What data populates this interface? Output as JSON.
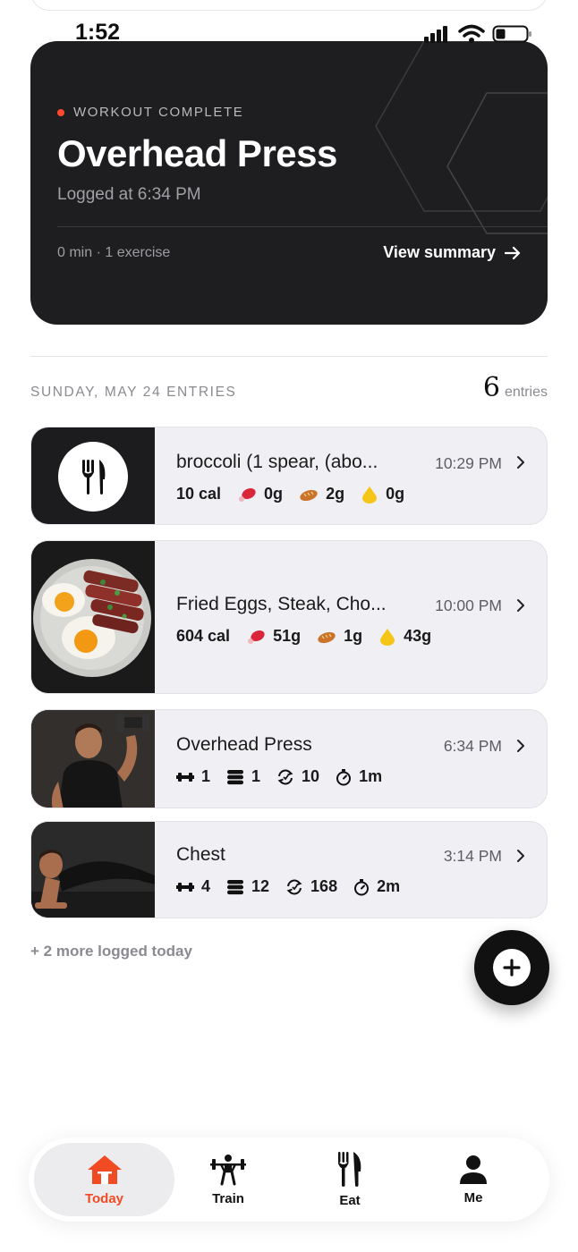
{
  "status_bar": {
    "time": "1:52"
  },
  "workout_card": {
    "label": "WORKOUT COMPLETE",
    "title": "Overhead Press",
    "logged": "Logged at 6:34 PM",
    "meta": "0 min · 1 exercise",
    "view_summary": "View summary",
    "accent": "#ff4a2e"
  },
  "section": {
    "date_heading": "SUNDAY, MAY 24 ENTRIES",
    "count": "6",
    "count_label": "entries"
  },
  "entries": [
    {
      "title": "broccoli (1 spear, (abo...",
      "time": "10:29 PM",
      "calories": "10 cal",
      "protein": "0g",
      "carbs": "2g",
      "fat": "0g"
    },
    {
      "title": "Fried Eggs, Steak, Cho...",
      "time": "10:00 PM",
      "calories": "604 cal",
      "protein": "51g",
      "carbs": "1g",
      "fat": "43g"
    },
    {
      "title": "Overhead Press",
      "time": "6:34 PM",
      "exercises": "1",
      "sets": "1",
      "reps": "10",
      "duration": "1m"
    },
    {
      "title": "Chest",
      "time": "3:14 PM",
      "exercises": "4",
      "sets": "12",
      "reps": "168",
      "duration": "2m"
    }
  ],
  "more_logged": "+ 2 more logged today",
  "nav": {
    "items": [
      {
        "label": "Today",
        "icon": "home-icon",
        "active": true
      },
      {
        "label": "Train",
        "icon": "weightlifter-icon",
        "active": false
      },
      {
        "label": "Eat",
        "icon": "fork-knife-icon",
        "active": false
      },
      {
        "label": "Me",
        "icon": "person-icon",
        "active": false
      }
    ],
    "active_color": "#f04b23"
  }
}
